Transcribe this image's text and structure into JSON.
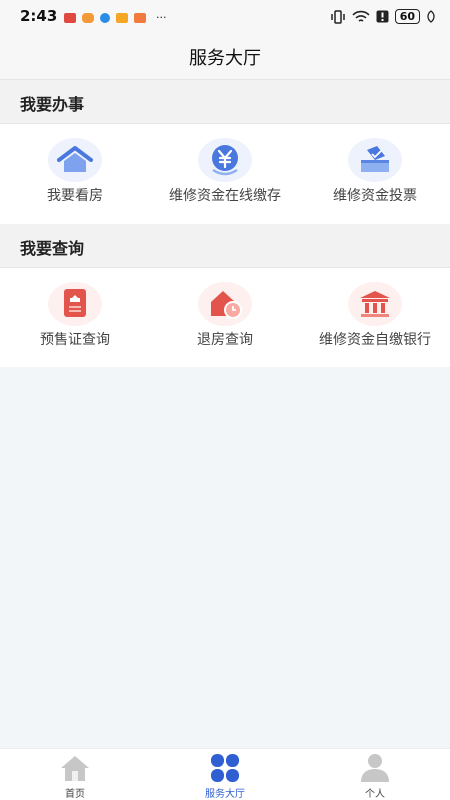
{
  "status": {
    "time": "2:43",
    "dots": "···",
    "battery": "60"
  },
  "header": {
    "title": "服务大厅"
  },
  "sections": [
    {
      "title": "我要办事",
      "items": [
        {
          "label": "我要看房",
          "icon": "house-icon"
        },
        {
          "label": "维修资金在线缴存",
          "icon": "yuan-coin-icon"
        },
        {
          "label": "维修资金投票",
          "icon": "vote-box-icon"
        }
      ]
    },
    {
      "title": "我要查询",
      "items": [
        {
          "label": "预售证查询",
          "icon": "certificate-icon"
        },
        {
          "label": "退房查询",
          "icon": "house-clock-icon"
        },
        {
          "label": "维修资金自缴银行",
          "icon": "bank-icon"
        }
      ]
    }
  ],
  "tabbar": {
    "tabs": [
      {
        "label": "首页",
        "icon": "home-icon"
      },
      {
        "label": "服务大厅",
        "icon": "grid-clover-icon",
        "active": true
      },
      {
        "label": "个人",
        "icon": "user-icon"
      }
    ]
  },
  "colors": {
    "accent": "#2f5fd1",
    "section_bg": "#f2f2f2",
    "page_bg": "#f3f6f9",
    "icon_red": "#e2544c",
    "icon_blue": "#5a86e3"
  }
}
